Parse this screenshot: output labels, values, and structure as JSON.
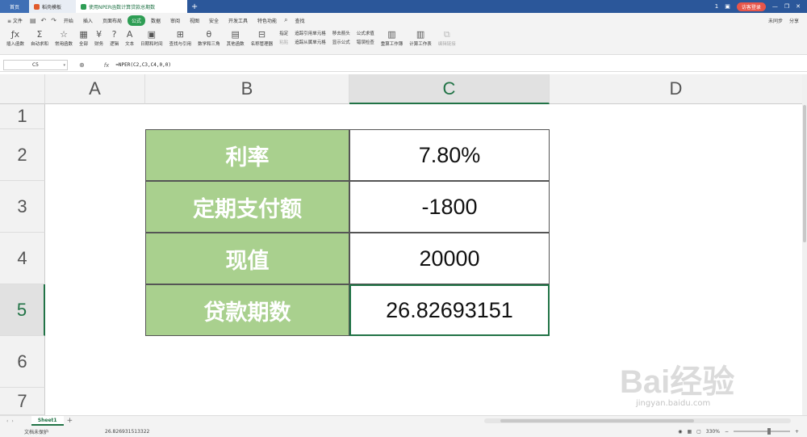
{
  "tabs": {
    "home": "首页",
    "t1": "稻壳模板",
    "t2": "使用NPER函数计算贷款总期数",
    "new": "+"
  },
  "titlebar": {
    "badge": "1",
    "login": "访客登录"
  },
  "menu": {
    "file": "≡ 文件",
    "items": [
      "开始",
      "插入",
      "页面布局",
      "公式",
      "数据",
      "审阅",
      "视图",
      "安全",
      "开发工具",
      "特色功能"
    ],
    "active": "公式",
    "search": "查找",
    "right": [
      "未同步",
      "分享"
    ]
  },
  "ribbon": {
    "b1": "插入函数",
    "b2": "自动求和",
    "b3": "常用函数",
    "b4": "全部",
    "b5": "财务",
    "b6": "逻辑",
    "b7": "文本",
    "b8": "日期和时间",
    "b9": "查找与引用",
    "b10": "数学和三角",
    "b11": "其他函数",
    "b12": "名称管理器",
    "c1a": "指定",
    "c1b": "粘贴",
    "c2a": "追踪引用单元格",
    "c2b": "追踪从属单元格",
    "c3a": "移去箭头",
    "c3b": "显示公式",
    "c4a": "公式求值",
    "c4b": "错误检查",
    "b13": "重算工作簿",
    "b14": "计算工作表",
    "b15": "编辑链接"
  },
  "formula_bar": {
    "namebox": "C5",
    "fx": "fx",
    "formula": "=NPER(C2,C3,C4,0,0)"
  },
  "columns": [
    "A",
    "B",
    "C",
    "D"
  ],
  "rows": [
    "1",
    "2",
    "3",
    "4",
    "5",
    "6",
    "7"
  ],
  "table": [
    {
      "label": "利率",
      "value": "7.80%"
    },
    {
      "label": "定期支付额",
      "value": "-1800"
    },
    {
      "label": "现值",
      "value": "20000"
    },
    {
      "label": "贷款期数",
      "value": "26.82693151"
    }
  ],
  "sheet_tab": "Sheet1",
  "status": {
    "protect": "文档未保护",
    "value": "26.826931513322",
    "zoom": "330%"
  },
  "watermark": {
    "brand": "Bai经验",
    "url": "jingyan.baidu.com"
  }
}
